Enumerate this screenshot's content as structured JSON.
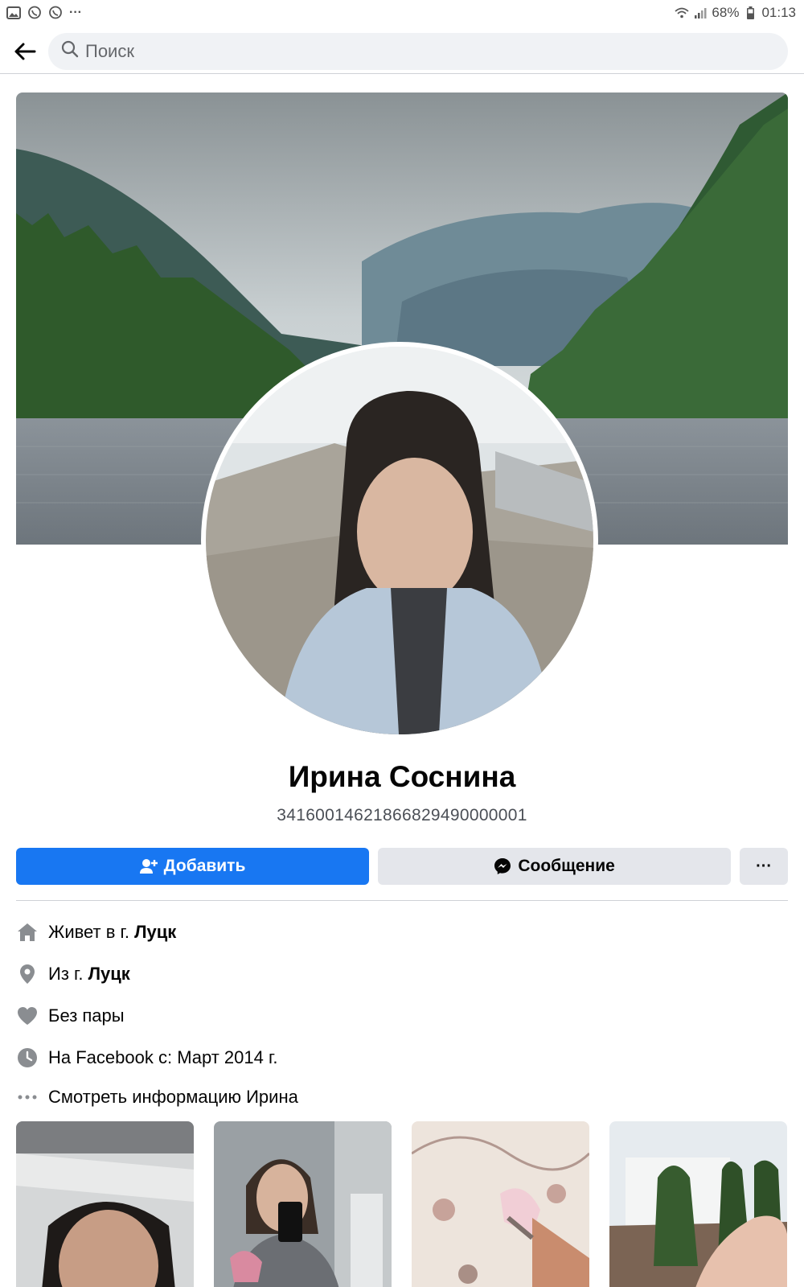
{
  "status_bar": {
    "more": "···",
    "battery": "68%",
    "time": "01:13"
  },
  "search": {
    "placeholder": "Поиск"
  },
  "profile": {
    "name": "Ирина Соснина",
    "id_text": "34160014621866829490000001"
  },
  "actions": {
    "add_label": "Добавить",
    "message_label": "Сообщение",
    "more_label": "···"
  },
  "info": {
    "lives_prefix": "Живет в г. ",
    "lives_city": "Луцк",
    "from_prefix": "Из г. ",
    "from_city": "Луцк",
    "relationship": "Без пары",
    "joined": "На Facebook с: Март 2014 г.",
    "see_more": "Смотреть информацию Ирина"
  },
  "colors": {
    "primary_blue": "#1877f2",
    "button_gray": "#e4e6eb",
    "icon_gray": "#8a8d91"
  }
}
